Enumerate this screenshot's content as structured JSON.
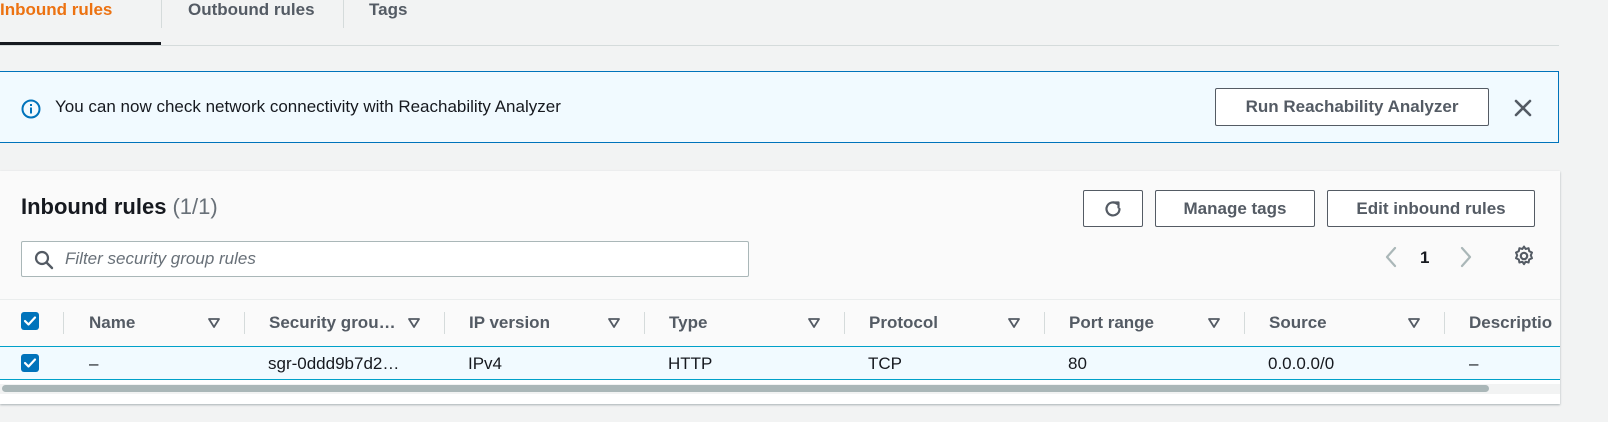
{
  "tabs": [
    {
      "label": "Inbound rules",
      "active": true
    },
    {
      "label": "Outbound rules",
      "active": false
    },
    {
      "label": "Tags",
      "active": false
    }
  ],
  "banner": {
    "icon": "info-icon",
    "text": "You can now check network connectivity with Reachability Analyzer",
    "button_label": "Run Reachability Analyzer",
    "close_icon": "close-icon"
  },
  "panel": {
    "title": "Inbound rules",
    "count": "(1/1)",
    "refresh_icon": "refresh-icon",
    "manage_tags_label": "Manage tags",
    "edit_rules_label": "Edit inbound rules",
    "search_placeholder": "Filter security group rules",
    "search_value": "",
    "page": "1",
    "settings_icon": "gear-icon"
  },
  "table": {
    "select_all_checked": true,
    "columns": [
      "Name",
      "Security grou…",
      "IP version",
      "Type",
      "Protocol",
      "Port range",
      "Source",
      "Descriptio"
    ],
    "rows": [
      {
        "checked": true,
        "cells": [
          "–",
          "sgr-0ddd9b7d2…",
          "IPv4",
          "HTTP",
          "TCP",
          "80",
          "0.0.0.0/0",
          "–"
        ]
      }
    ]
  },
  "colors": {
    "active_tab": "#ec7211",
    "accent_blue": "#0073bb",
    "banner_bg": "#f1faff",
    "selected_row_bg": "#f1faff"
  }
}
